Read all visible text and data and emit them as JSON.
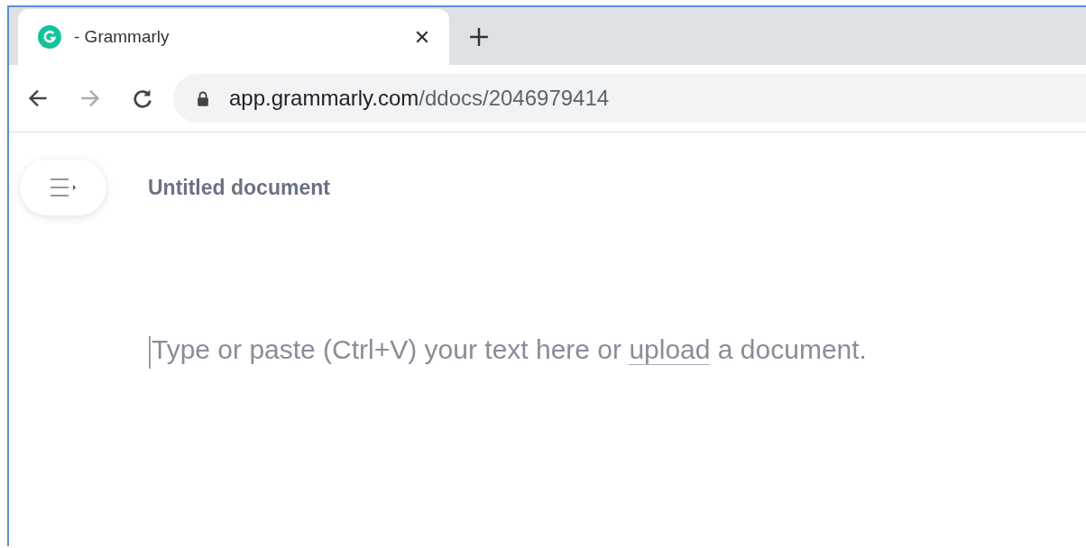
{
  "tab": {
    "title": "- Grammarly",
    "selected": true
  },
  "address_bar": {
    "host": "app.grammarly.com",
    "path": "/ddocs/2046979414"
  },
  "document": {
    "title": "Untitled document",
    "placeholder_before": "Type or paste (Ctrl+V) your text here or",
    "placeholder_link": "upload",
    "placeholder_after": "a document."
  }
}
